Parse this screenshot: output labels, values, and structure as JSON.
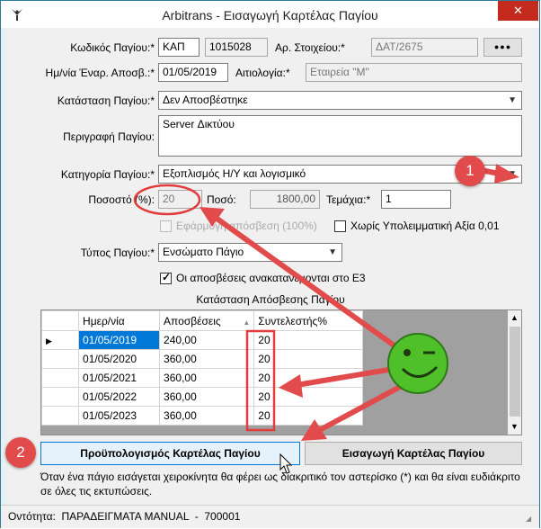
{
  "window": {
    "title": "Arbitrans - Εισαγωγή Καρτέλας Παγίου",
    "close_glyph": "✕"
  },
  "fields": {
    "code_label": "Κωδικός Παγίου:*",
    "code_prefix": "ΚΑΠ",
    "code_number": "1015028",
    "item_no_label": "Αρ. Στοιχείου:*",
    "item_no_value": "ΔΑΤ/2675",
    "more_button": "●●●",
    "date_label": "Ημ/νία Έναρ. Αποσβ.:*",
    "date_value": "01/05/2019",
    "reason_label": "Αιτιολογία:*",
    "reason_value": "Εταιρεία \"Μ\"",
    "status_label": "Κατάσταση Παγίου:*",
    "status_value": "Δεν Αποσβέστηκε",
    "desc_label": "Περιγραφή Παγίου:",
    "desc_value": "Server Δικτύου",
    "category_label": "Κατηγορία Παγίου:*",
    "category_value": "Εξοπλισμός Η/Υ και λογισμικό",
    "percent_label": "Ποσοστό (%):",
    "percent_value": "20",
    "amount_label": "Ποσό:",
    "amount_value": "1800,00",
    "pieces_label": "Τεμάχια:*",
    "pieces_value": "1",
    "apply_depr_label": "Εφάρμογή απόσβεση (100%)",
    "no_residual_label": "Χωρίς Υπολειμματική Αξία 0,01",
    "type_label": "Τύπος Παγίου:*",
    "type_value": "Ενσώματο Πάγιο",
    "e3_label": "Οι αποσβέσεις ανακατανέμονται στο Ε3"
  },
  "grid": {
    "caption": "Κατάσταση Απόσβεσης Παγίου",
    "columns": [
      "Ημερ/νία",
      "Αποσβέσεις",
      "Συντελεστής%"
    ],
    "sort_glyph": "▲",
    "rows": [
      {
        "date": "01/05/2019",
        "amount": "240,00",
        "rate": "20"
      },
      {
        "date": "01/05/2020",
        "amount": "360,00",
        "rate": "20"
      },
      {
        "date": "01/05/2021",
        "amount": "360,00",
        "rate": "20"
      },
      {
        "date": "01/05/2022",
        "amount": "360,00",
        "rate": "20"
      },
      {
        "date": "01/05/2023",
        "amount": "360,00",
        "rate": "20"
      }
    ]
  },
  "buttons": {
    "budget": "Προϋπολογισμός Καρτέλας Παγίου",
    "insert": "Εισαγωγή Καρτέλας Παγίου"
  },
  "note": "Όταν ένα πάγιο εισάγεται χειροκίνητα θα φέρει ως διακριτικό τον αστερίσκο (*) και θα είναι ευδιάκριτο σε όλες τις εκτυπώσεις.",
  "status": "Οντότητα:  ΠΑΡΑΔΕΙΓΜΑΤΑ MANUAL  -  700001",
  "callouts": {
    "one": "1",
    "two": "2"
  },
  "colors": {
    "accent": "#e24b4b",
    "close_btn": "#c42b1c",
    "smiley": "#4fc02a"
  }
}
